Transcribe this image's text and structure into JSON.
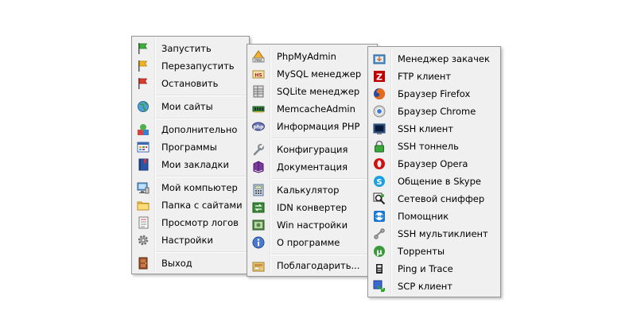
{
  "colors": {
    "menu_bg": "#f0f0f0",
    "menu_border": "#979797",
    "separator": "#e0e0e0"
  },
  "main_menu": [
    {
      "label": "Запустить",
      "icon": "green-flag-icon"
    },
    {
      "label": "Перезапустить",
      "icon": "yellow-flag-icon"
    },
    {
      "label": "Остановить",
      "icon": "red-flag-icon"
    },
    {
      "label": "Мои сайты",
      "icon": "globe-icon"
    },
    {
      "label": "Дополнительно",
      "icon": "shapes-icon"
    },
    {
      "label": "Программы",
      "icon": "window-grid-icon"
    },
    {
      "label": "Мои закладки",
      "icon": "bookmark-book-icon"
    },
    {
      "label": "Мой компьютер",
      "icon": "computer-icon"
    },
    {
      "label": "Папка с сайтами",
      "icon": "folder-icon"
    },
    {
      "label": "Просмотр логов",
      "icon": "log-notepad-icon"
    },
    {
      "label": "Настройки",
      "icon": "gear-icon"
    },
    {
      "label": "Выход",
      "icon": "exit-door-icon"
    }
  ],
  "additional_menu": [
    {
      "label": "PhpMyAdmin",
      "icon": "phpmyadmin-icon"
    },
    {
      "label": "MySQL менеджер",
      "icon": "mysql-manager-icon"
    },
    {
      "label": "SQLite менеджер",
      "icon": "sqlite-manager-icon"
    },
    {
      "label": "MemcacheAdmin",
      "icon": "memory-chip-icon"
    },
    {
      "label": "Информация PHP",
      "icon": "php-icon"
    },
    {
      "label": "Конфигурация",
      "icon": "wrench-icon"
    },
    {
      "label": "Документация",
      "icon": "book-icon"
    },
    {
      "label": "Калькулятор",
      "icon": "calculator-icon"
    },
    {
      "label": "IDN конвертер",
      "icon": "idn-converter-icon"
    },
    {
      "label": "Win настройки",
      "icon": "win-settings-icon"
    },
    {
      "label": "О программе",
      "icon": "info-icon"
    },
    {
      "label": "Поблагодарить...",
      "icon": "gift-icon"
    }
  ],
  "programs_menu": [
    {
      "label": "Менеджер закачек",
      "icon": "download-manager-icon"
    },
    {
      "label": "FTP клиент",
      "icon": "filezilla-icon"
    },
    {
      "label": "Браузер Firefox",
      "icon": "firefox-icon"
    },
    {
      "label": "Браузер Chrome",
      "icon": "chrome-icon"
    },
    {
      "label": "SSH клиент",
      "icon": "ssh-terminal-icon"
    },
    {
      "label": "SSH тоннель",
      "icon": "padlock-icon"
    },
    {
      "label": "Браузер Opera",
      "icon": "opera-icon"
    },
    {
      "label": "Общение в Skype",
      "icon": "skype-icon"
    },
    {
      "label": "Сетевой сниффер",
      "icon": "sniffer-icon"
    },
    {
      "label": "Помощник",
      "icon": "teamviewer-icon"
    },
    {
      "label": "SSH мультиклиент",
      "icon": "ssh-multiclient-icon"
    },
    {
      "label": "Торренты",
      "icon": "utorrent-icon"
    },
    {
      "label": "Ping и Trace",
      "icon": "ping-trace-icon"
    },
    {
      "label": "SCP клиент",
      "icon": "scp-client-icon"
    }
  ]
}
